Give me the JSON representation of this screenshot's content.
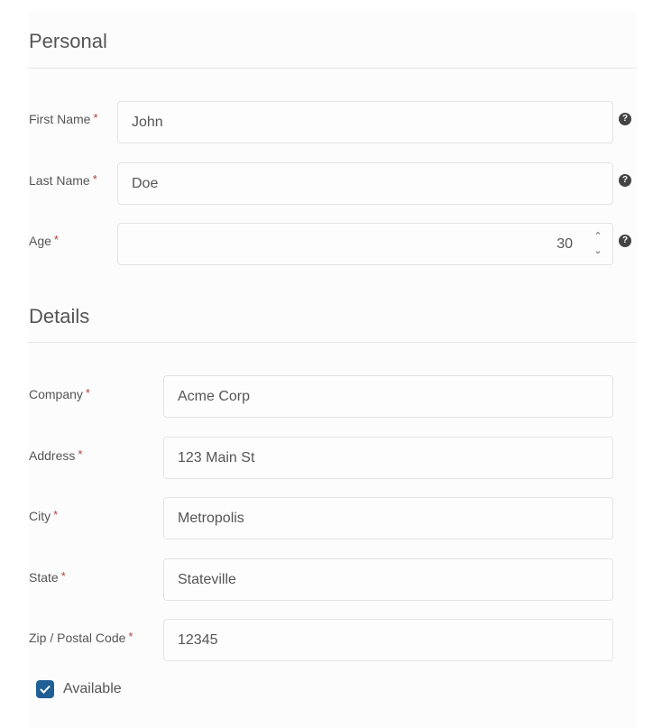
{
  "sections": {
    "personal": {
      "title": "Personal",
      "fields": {
        "first_name": {
          "label": "First Name",
          "required": "*",
          "value": "John"
        },
        "last_name": {
          "label": "Last Name",
          "required": "*",
          "value": "Doe"
        },
        "age": {
          "label": "Age",
          "required": "*",
          "value": "30"
        }
      }
    },
    "details": {
      "title": "Details",
      "fields": {
        "company": {
          "label": "Company",
          "required": "*",
          "value": "Acme Corp"
        },
        "address": {
          "label": "Address",
          "required": "*",
          "value": "123 Main St"
        },
        "city": {
          "label": "City",
          "required": "*",
          "value": "Metropolis"
        },
        "state": {
          "label": "State",
          "required": "*",
          "value": "Stateville"
        },
        "zip": {
          "label": "Zip / Postal Code",
          "required": "*",
          "value": "12345"
        }
      }
    }
  },
  "available": {
    "label": "Available",
    "checked": true
  },
  "icons": {
    "help": "?",
    "spin_up": "⌃",
    "spin_down": "⌄",
    "check": "check-icon"
  },
  "colors": {
    "required": "#a94442",
    "checkbox": "#1f5f95",
    "help_icon": "#444444"
  }
}
